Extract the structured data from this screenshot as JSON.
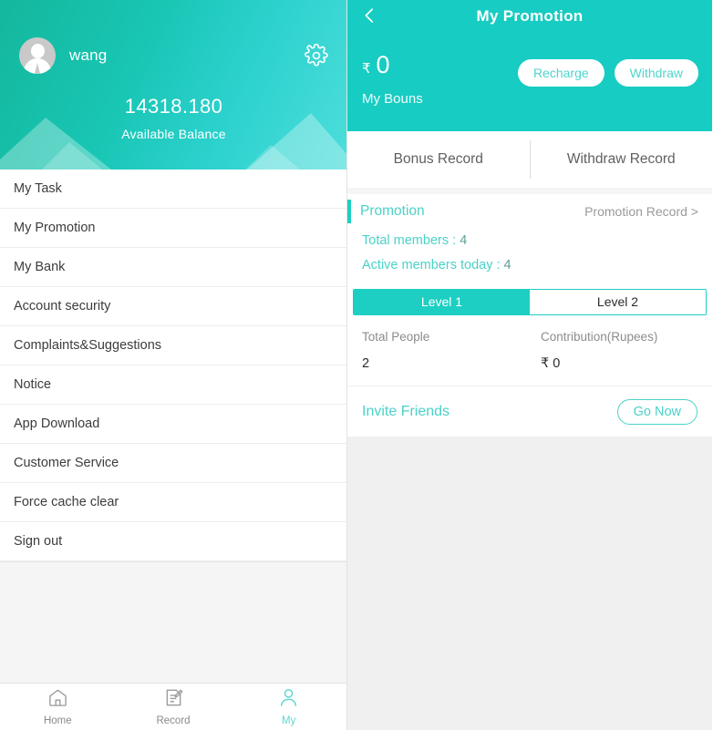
{
  "left": {
    "profile": {
      "avatar_icon": "user-avatar-icon",
      "user_name": "wang",
      "settings_icon": "gear-icon",
      "balance_amount": "14318.180",
      "balance_label": "Available Balance",
      "gradient_from": "#14b79c",
      "gradient_to": "#4ddedb"
    },
    "menu": [
      {
        "label": "My Task",
        "name": "my-task"
      },
      {
        "label": "My Promotion",
        "name": "my-promotion"
      },
      {
        "label": "My Bank",
        "name": "my-bank"
      },
      {
        "label": "Account security",
        "name": "account-security"
      },
      {
        "label": "Complaints&Suggestions",
        "name": "complaints-suggestions"
      },
      {
        "label": "Notice",
        "name": "notice"
      },
      {
        "label": "App Download",
        "name": "app-download"
      },
      {
        "label": "Customer Service",
        "name": "customer-service"
      },
      {
        "label": "Force cache clear",
        "name": "force-cache-clear"
      },
      {
        "label": "Sign out",
        "name": "sign-out"
      }
    ],
    "bottom_nav": {
      "items": [
        {
          "label": "Home",
          "icon": "home-icon",
          "active": false
        },
        {
          "label": "Record",
          "icon": "record-note-icon",
          "active": false
        },
        {
          "label": "My",
          "icon": "person-icon",
          "active": true
        }
      ],
      "active_color": "#5bd7cf",
      "inactive_color": "#8a8a8a"
    }
  },
  "right": {
    "header": {
      "back_icon": "chevron-left-icon",
      "title": "My Promotion",
      "currency_symbol": "₹",
      "bonus_amount": "0",
      "bonus_label": "My Bouns",
      "recharge_label": "Recharge",
      "withdraw_label": "Withdraw",
      "background_color": "#17ccc2"
    },
    "record_tabs": [
      {
        "label": "Bonus Record",
        "name": "bonus-record"
      },
      {
        "label": "Withdraw Record",
        "name": "withdraw-record"
      }
    ],
    "promotion": {
      "title": "Promotion",
      "record_link": "Promotion Record >",
      "total_members_label": "Total members :",
      "total_members_value": "4",
      "active_members_label": "Active members today :",
      "active_members_value": "4",
      "accent_color": "#1dcfc3"
    },
    "level_tabs": [
      {
        "label": "Level 1",
        "active": true
      },
      {
        "label": "Level 2",
        "active": false
      }
    ],
    "stats": {
      "headers": [
        "Total People",
        "Contribution(Rupees)"
      ],
      "values": [
        "2",
        "₹ 0"
      ]
    },
    "invite": {
      "label": "Invite Friends",
      "button_label": "Go Now"
    }
  }
}
